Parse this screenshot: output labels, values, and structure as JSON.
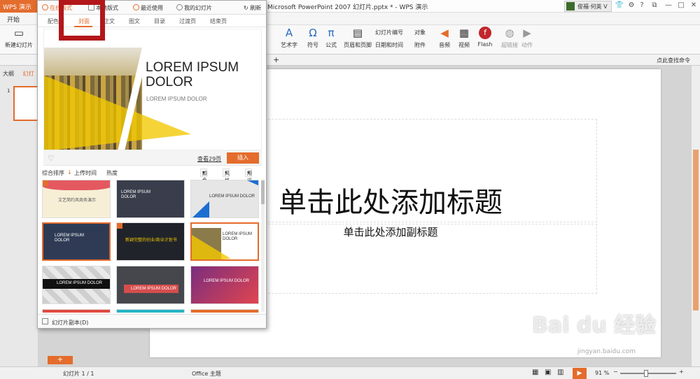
{
  "titlebar": {
    "app_tab": "WPS 演示",
    "window_title": "Microsoft PowerPoint 2007 幻灯片.pptx * - WPS 演示",
    "user": "俊福·何英 V",
    "refresh": "刷新"
  },
  "ribbon": {
    "tab_start": "开始",
    "new_slide": "新建幻灯片",
    "wordart": "艺术字",
    "symbol": "符号",
    "formula": "公式",
    "header_footer": "页眉和页脚",
    "slide_number": "幻灯片编号",
    "object": "对象",
    "datetime": "日期和时间",
    "attachment": "附件",
    "audio": "音频",
    "video": "视频",
    "flash": "Flash",
    "hyperlink": "超链接",
    "action": "动作",
    "find": "点此查找命令"
  },
  "left_pane": {
    "tab_outline": "大纲",
    "tab_slides": "幻灯",
    "slide_index": "1"
  },
  "slide": {
    "title_placeholder": "单击此处添加标题",
    "subtitle_placeholder": "单击此处添加副标题"
  },
  "panel": {
    "tabs": [
      "在线版式",
      "本地版式",
      "最近使用",
      "我的幻灯片"
    ],
    "refresh": "刷新",
    "sub_tabs": [
      "配色页",
      "封面",
      "正文",
      "图文",
      "目录",
      "过渡页",
      "结束页"
    ],
    "preview_title": "LOREM IPSUM DOLOR",
    "preview_sub": "LOREM IPSUM DOLOR",
    "view_more": "查看29页",
    "insert": "插入",
    "sort": [
      "综合排序",
      "上传时间",
      "热度"
    ],
    "filters": [
      "颜色",
      "风格",
      "用途"
    ],
    "thumbs": [
      "文艺简约风商务演示",
      "LOREM IPSUM DOLOR",
      "LOREM IPSUM DOLOR",
      "LOREM IPSUM DOLOR",
      "新颖完整的创业/商业计划书",
      "LOREM IPSUM DOLOR",
      "LOREM IPSUM DOLOR",
      "LOREM IPSUM DOLOR",
      "LOREM IPSUM DOLOR"
    ],
    "footer": "幻灯片副本(D)"
  },
  "statusbar": {
    "slide_count": "幻灯片 1 / 1",
    "theme": "Office 主题",
    "zoom": "91 %"
  },
  "watermark": "Bai du 经验",
  "watermark_url": "jingyan.baidu.com",
  "colors": {
    "accent": "#e46c2c",
    "highlight": "#b3171a"
  }
}
